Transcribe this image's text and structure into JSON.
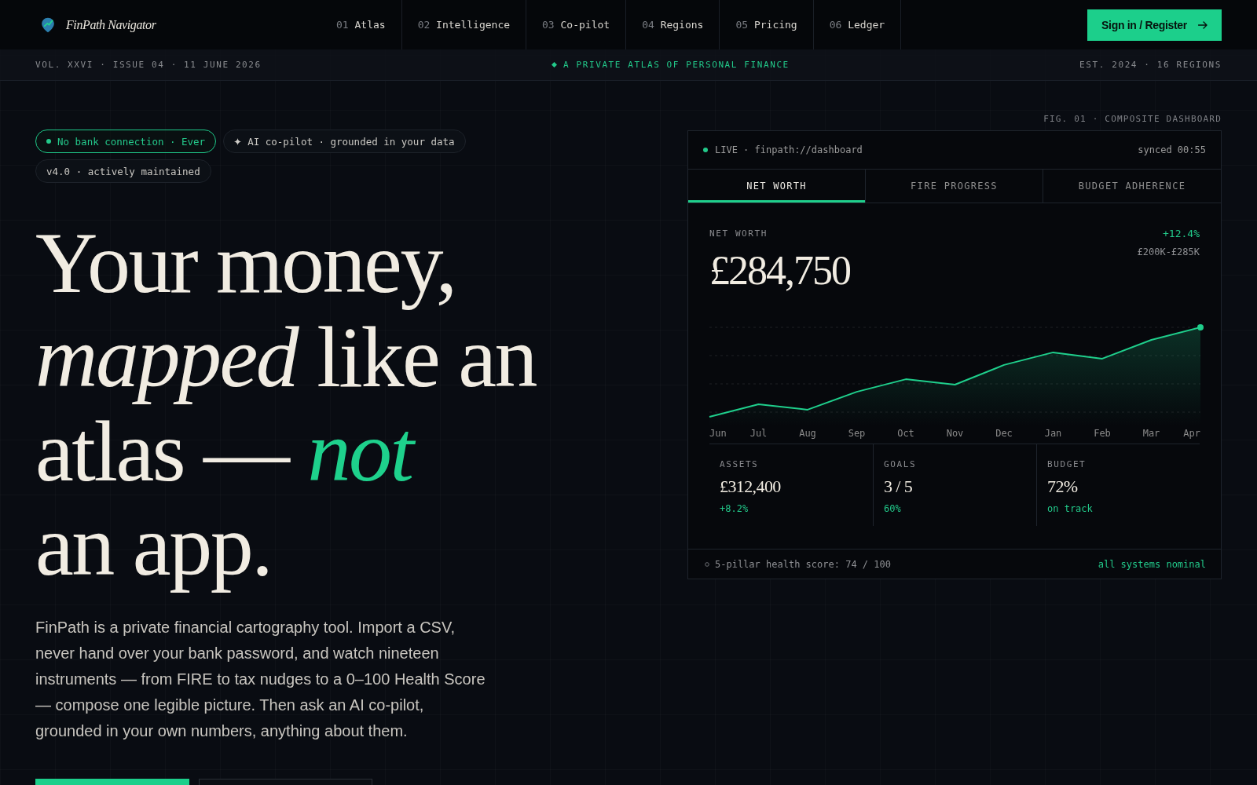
{
  "header": {
    "brand": "FinPath Navigator",
    "nav": [
      {
        "number": "01",
        "label": "Atlas"
      },
      {
        "number": "02",
        "label": "Intelligence"
      },
      {
        "number": "03",
        "label": "Co-pilot"
      },
      {
        "number": "04",
        "label": "Regions"
      },
      {
        "number": "05",
        "label": "Pricing"
      },
      {
        "number": "06",
        "label": "Ledger"
      }
    ],
    "sign_in": "Sign in / Register"
  },
  "masthead": {
    "issue": "VOL. XXVI · ISSUE 04 · 11 JUNE 2026",
    "tagline": "A PRIVATE ATLAS OF PERSONAL FINANCE",
    "established": "EST. 2024 · 16 REGIONS"
  },
  "hero": {
    "badges": [
      {
        "kind": "accent",
        "text": "No bank connection · Ever"
      },
      {
        "kind": "sparkle",
        "text": "AI co-pilot · grounded in your data"
      },
      {
        "kind": "plain",
        "text": "v4.0 · actively maintained"
      }
    ],
    "headline": [
      [
        {
          "kind": "roman",
          "text": "Your money,"
        }
      ],
      [
        {
          "kind": "italic",
          "text": "mapped"
        },
        {
          "kind": "roman",
          "text": " like an"
        }
      ],
      [
        {
          "kind": "roman",
          "text": "atlas — "
        },
        {
          "kind": "accent",
          "text": "not"
        }
      ],
      [
        {
          "kind": "roman",
          "text": "an app."
        }
      ]
    ],
    "intro": "FinPath is a private financial cartography tool. Import a CSV, never hand over your bank password, and watch nineteen instruments — from FIRE to tax nudges to a 0–100 Health Score — compose one legible picture. Then ask an AI co-pilot, grounded in your own numbers, anything about them.",
    "actions": [
      {
        "kind": "primary"
      },
      {
        "kind": "secondary"
      }
    ]
  },
  "dashboard": {
    "caption": "FIG. 01 · COMPOSITE DASHBOARD",
    "source": "LIVE · finpath://dashboard",
    "synced": "synced 00:55",
    "tabs": [
      {
        "label": "NET WORTH",
        "selected": true
      },
      {
        "label": "FIRE PROGRESS",
        "selected": false
      },
      {
        "label": "BUDGET ADHERENCE",
        "selected": false
      }
    ],
    "metric": {
      "label": "NET WORTH",
      "value": "£284,750",
      "change": "+12.4%",
      "range": "£200K-£285K"
    },
    "trend": {
      "months": [
        "Jun",
        "Jul",
        "Aug",
        "Sep",
        "Oct",
        "Nov",
        "Dec",
        "Jan",
        "Feb",
        "Mar",
        "Apr"
      ]
    },
    "stats": [
      {
        "label": "ASSETS",
        "value": "£312,400",
        "note": "+8.2%"
      },
      {
        "label": "GOALS",
        "value": "3 / 5",
        "note": "60%"
      },
      {
        "label": "BUDGET",
        "value": "72%",
        "note": "on track"
      }
    ],
    "footer": {
      "score": "5-pillar health score: 74 / 100",
      "status": "all systems nominal"
    }
  }
}
